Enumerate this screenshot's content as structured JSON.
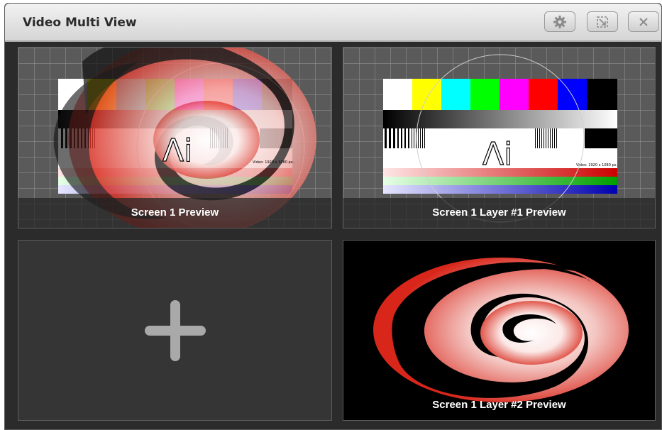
{
  "window": {
    "title": "Video Multi View",
    "buttons": [
      {
        "name": "settings",
        "icon": "gear-icon"
      },
      {
        "name": "resize",
        "icon": "resize-icon"
      },
      {
        "name": "close",
        "icon": "close-icon"
      }
    ]
  },
  "tiles": [
    {
      "caption": "Screen 1 Preview",
      "content": "test-card-with-spiral-overlay"
    },
    {
      "caption": "Screen 1 Layer #1 Preview",
      "content": "test-card"
    },
    {
      "caption": "",
      "content": "empty",
      "icon": "plus-icon"
    },
    {
      "caption": "Screen 1 Layer #2 Preview",
      "content": "spiral-logo"
    }
  ],
  "test_card": {
    "logo_text": "Λi",
    "resolution_text": "Video: 1920 x 1080 px.",
    "colors": [
      "#ffffff",
      "#ffff00",
      "#00ffff",
      "#00ff00",
      "#ff00ff",
      "#ff0000",
      "#0000ff",
      "#000000"
    ]
  },
  "colors": {
    "window_bg": "#2b2b2b",
    "titlebar": "#e3e3e3",
    "spiral_red": "#d8261a",
    "plus": "#a9a9a9"
  }
}
